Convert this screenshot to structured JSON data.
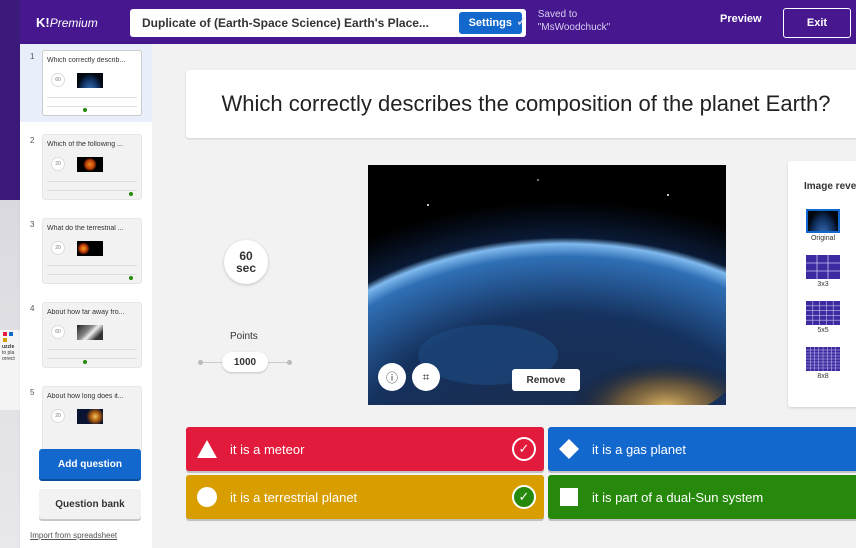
{
  "app": {
    "logo": "K!",
    "logo_tier": "Premium"
  },
  "header": {
    "title": "Duplicate of (Earth-Space Science) Earth's Place...",
    "settings_label": "Settings",
    "saved_line1": "Saved to",
    "saved_line2": "\"MsWoodchuck\"",
    "preview_label": "Preview",
    "exit_label": "Exit"
  },
  "sidebar": {
    "items": [
      {
        "num": "1",
        "title": "Which correctly describ...",
        "timer": "60"
      },
      {
        "num": "2",
        "title": "Which of the following ...",
        "timer": "20"
      },
      {
        "num": "3",
        "title": "What do the terrestrial ...",
        "timer": "20"
      },
      {
        "num": "4",
        "title": "About how far away fro...",
        "timer": "60"
      },
      {
        "num": "5",
        "title": "About how long does it...",
        "timer": "20"
      }
    ],
    "add_question": "Add question",
    "question_bank": "Question bank",
    "import": "Import from spreadsheet"
  },
  "question": {
    "text": "Which correctly describes the composition of the planet Earth?",
    "timer_value": "60",
    "timer_unit": "sec",
    "points_label": "Points",
    "points_value": "1000",
    "remove_label": "Remove"
  },
  "reveal": {
    "title": "Image reveal",
    "options": [
      {
        "label": "Original"
      },
      {
        "label": "3x3"
      },
      {
        "label": "5x5"
      },
      {
        "label": "8x8"
      }
    ]
  },
  "answers": [
    {
      "text": "it is a meteor",
      "color": "#e21b3c",
      "shape": "triangle",
      "correct": true
    },
    {
      "text": "it is a gas planet",
      "color": "#1368ce",
      "shape": "diamond",
      "correct": false
    },
    {
      "text": "it is a terrestrial planet",
      "color": "#d89e00",
      "shape": "circle",
      "correct": true
    },
    {
      "text": "it is part of a dual-Sun system",
      "color": "#26890c",
      "shape": "square",
      "correct": false
    }
  ],
  "background_fragment": {
    "text1": "uzzle",
    "text2": "to pla",
    "text3": "orrect"
  }
}
